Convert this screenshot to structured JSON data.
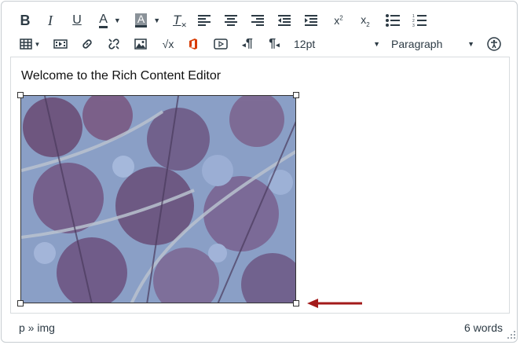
{
  "toolbar": {
    "row1": [
      {
        "icon": "bold-icon",
        "label": "B"
      },
      {
        "icon": "italic-icon",
        "label": "I"
      },
      {
        "icon": "underline-icon",
        "label": "U"
      },
      {
        "icon": "text-color-icon",
        "label": "A"
      },
      {
        "icon": "background-color-icon",
        "label": "A"
      },
      {
        "icon": "clear-formatting-icon",
        "label": "T"
      },
      {
        "icon": "align-left-icon"
      },
      {
        "icon": "align-center-icon"
      },
      {
        "icon": "align-right-icon"
      },
      {
        "icon": "outdent-icon"
      },
      {
        "icon": "indent-icon"
      },
      {
        "icon": "superscript-icon",
        "label": "x"
      },
      {
        "icon": "subscript-icon",
        "label": "x"
      },
      {
        "icon": "bullet-list-icon"
      },
      {
        "icon": "numbered-list-icon"
      }
    ],
    "row2": [
      {
        "icon": "table-icon"
      },
      {
        "icon": "media-icon"
      },
      {
        "icon": "link-icon"
      },
      {
        "icon": "unlink-icon"
      },
      {
        "icon": "image-icon"
      },
      {
        "icon": "math-icon",
        "label": "√x"
      },
      {
        "icon": "office-icon"
      },
      {
        "icon": "video-icon"
      },
      {
        "icon": "ltr-paragraph-icon",
        "label": "¶"
      },
      {
        "icon": "rtl-paragraph-icon",
        "label": "¶"
      },
      {
        "icon": "accessibility-icon"
      }
    ],
    "font_size": "12pt",
    "format": "Paragraph",
    "colors": {
      "icon": "#2d3b45",
      "office": "#d83b01"
    }
  },
  "editor": {
    "content": "Welcome to the Rich Content Editor",
    "image_icon": "image-with-tree-leaves",
    "arrow_color": "#a31a1a"
  },
  "status": {
    "path": "p » img",
    "word_count": "6 words"
  }
}
